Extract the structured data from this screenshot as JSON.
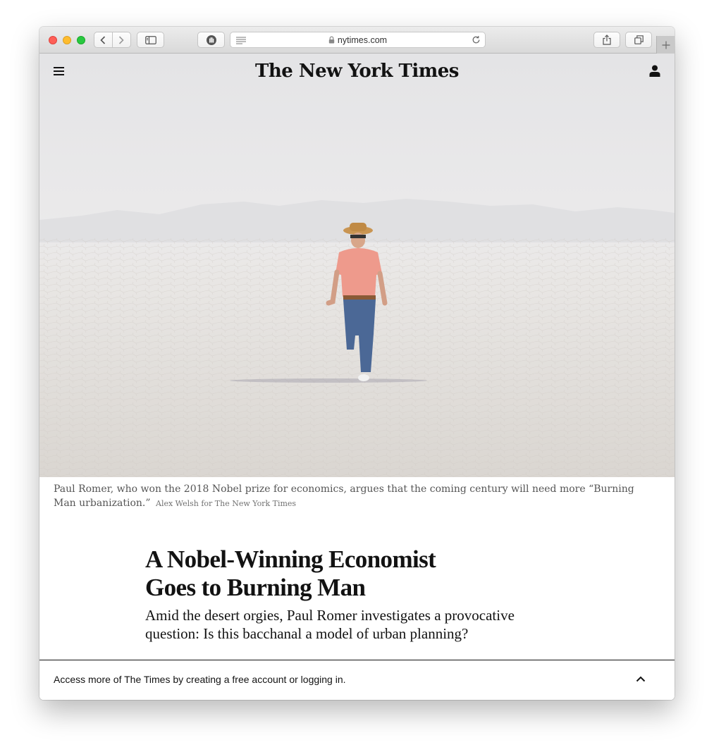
{
  "browser": {
    "url": "nytimes.com",
    "colors": {
      "close": "#fe5f57",
      "minimize": "#febc2e",
      "zoom": "#28c840"
    }
  },
  "masthead": {
    "logo": "The New York Times"
  },
  "hero": {
    "caption": "Paul Romer, who won the 2018 Nobel prize for economics, argues that the coming century will need more “Burning Man urbanization.”",
    "credit": "Alex Welsh for The New York Times"
  },
  "article": {
    "headline_line1": "A Nobel-Winning Economist",
    "headline_line2": "Goes to Burning Man",
    "deck": "Amid the desert orgies, Paul Romer investigates a provocative question: Is this bacchanal a model of urban planning?"
  },
  "banner": {
    "text": "Access more of The Times by creating a free account or logging in."
  }
}
